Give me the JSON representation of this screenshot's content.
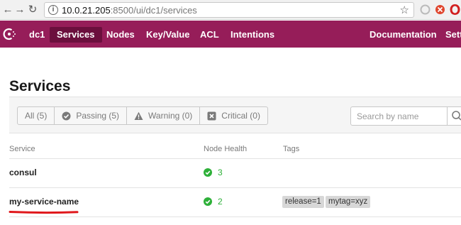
{
  "browser": {
    "url_host": "10.0.21.205",
    "url_path": ":8500/ui/dc1/services",
    "back_icon": "back-arrow-icon",
    "forward_icon": "forward-arrow-icon",
    "reload_icon": "reload-icon"
  },
  "nav": {
    "datacenter": "dc1",
    "items": [
      "Services",
      "Nodes",
      "Key/Value",
      "ACL",
      "Intentions"
    ],
    "right_items": [
      "Documentation",
      "Settings"
    ],
    "bg_color": "#961d59",
    "active_color": "#6b0f3d"
  },
  "page": {
    "title": "Services"
  },
  "filters": [
    {
      "label": "All (5)",
      "icon": ""
    },
    {
      "label": "Passing (5)",
      "icon": "check-circle-icon"
    },
    {
      "label": "Warning (0)",
      "icon": "warning-triangle-icon"
    },
    {
      "label": "Critical (0)",
      "icon": "critical-x-icon"
    }
  ],
  "search": {
    "placeholder": "Search by name"
  },
  "table": {
    "columns": [
      "Service",
      "Node Health",
      "Tags"
    ],
    "rows": [
      {
        "name": "consul",
        "health_count": "3",
        "tags": []
      },
      {
        "name": "my-service-name",
        "health_count": "2",
        "tags": [
          "release=1",
          "mytag=xyz"
        ]
      }
    ]
  },
  "colors": {
    "passing": "#2eb039",
    "annotation_underline": "#e0181c"
  }
}
